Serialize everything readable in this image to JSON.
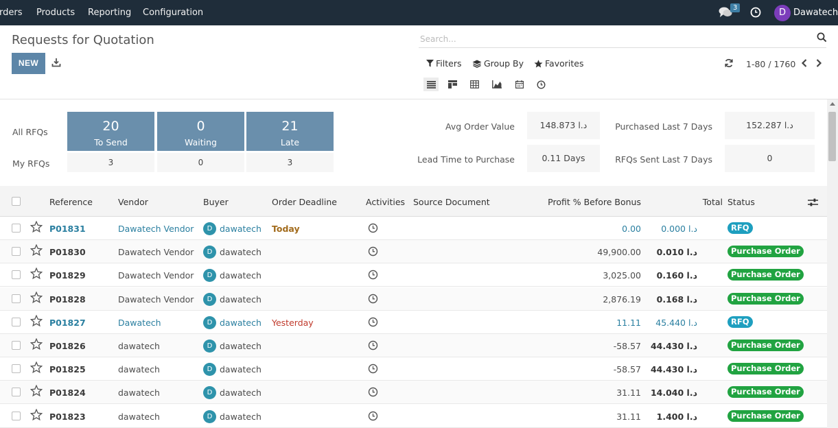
{
  "navbar": {
    "items": [
      "rders",
      "Products",
      "Reporting",
      "Configuration"
    ],
    "chat_badge": "3",
    "user_initial": "D",
    "user_name": "Dawatech"
  },
  "control": {
    "title": "Requests for Quotation",
    "new_label": "NEW",
    "search_placeholder": "Search...",
    "filters_label": "Filters",
    "groupby_label": "Group By",
    "favorites_label": "Favorites",
    "pager": "1-80 / 1760"
  },
  "dashboard": {
    "all_rfqs_label": "All RFQs",
    "my_rfqs_label": "My RFQs",
    "cards": [
      {
        "value": "20",
        "caption": "To Send",
        "my": "3"
      },
      {
        "value": "0",
        "caption": "Waiting",
        "my": "0"
      },
      {
        "value": "21",
        "caption": "Late",
        "my": "3"
      }
    ],
    "stats": [
      {
        "label": "Avg Order Value",
        "value": "148.873  د.ا"
      },
      {
        "label": "Purchased Last 7 Days",
        "value": "152.287  د.ا"
      },
      {
        "label": "Lead Time to Purchase",
        "value": "0.11  Days"
      },
      {
        "label": "RFQs Sent Last 7 Days",
        "value": "0"
      }
    ]
  },
  "table": {
    "headers": {
      "reference": "Reference",
      "vendor": "Vendor",
      "buyer": "Buyer",
      "deadline": "Order Deadline",
      "activities": "Activities",
      "source": "Source Document",
      "profit": "Profit % Before Bonus",
      "total": "Total",
      "status": "Status"
    },
    "rows": [
      {
        "ref": "P01831",
        "vendor": "Dawatech Vendor",
        "buyer": "dawatech",
        "buyer_initial": "D",
        "deadline": "Today",
        "profit": "0.00",
        "total": "0.000  د.ا",
        "status": "RFQ"
      },
      {
        "ref": "P01830",
        "vendor": "Dawatech Vendor",
        "buyer": "dawatech",
        "buyer_initial": "D",
        "deadline": "",
        "profit": "49,900.00",
        "total": "0.010  د.ا",
        "status": "Purchase Order"
      },
      {
        "ref": "P01829",
        "vendor": "Dawatech Vendor",
        "buyer": "dawatech",
        "buyer_initial": "D",
        "deadline": "",
        "profit": "3,025.00",
        "total": "0.160  د.ا",
        "status": "Purchase Order"
      },
      {
        "ref": "P01828",
        "vendor": "Dawatech Vendor",
        "buyer": "dawatech",
        "buyer_initial": "D",
        "deadline": "",
        "profit": "2,876.19",
        "total": "0.168  د.ا",
        "status": "Purchase Order"
      },
      {
        "ref": "P01827",
        "vendor": "Dawatech",
        "buyer": "dawatech",
        "buyer_initial": "D",
        "deadline": "Yesterday",
        "profit": "11.11",
        "total": "45.440  د.ا",
        "status": "RFQ"
      },
      {
        "ref": "P01826",
        "vendor": "dawatech",
        "buyer": "dawatech",
        "buyer_initial": "D",
        "deadline": "",
        "profit": "-58.57",
        "total": "44.430  د.ا",
        "status": "Purchase Order"
      },
      {
        "ref": "P01825",
        "vendor": "dawatech",
        "buyer": "dawatech",
        "buyer_initial": "D",
        "deadline": "",
        "profit": "-58.57",
        "total": "44.430  د.ا",
        "status": "Purchase Order"
      },
      {
        "ref": "P01824",
        "vendor": "dawatech",
        "buyer": "dawatech",
        "buyer_initial": "D",
        "deadline": "",
        "profit": "31.11",
        "total": "14.040  د.ا",
        "status": "Purchase Order"
      },
      {
        "ref": "P01823",
        "vendor": "dawatech",
        "buyer": "dawatech",
        "buyer_initial": "D",
        "deadline": "",
        "profit": "31.11",
        "total": "1.400  د.ا",
        "status": "Purchase Order"
      }
    ]
  },
  "colors": {
    "navbar": "#1f2d3a",
    "primary": "#5d86a8",
    "kpi": "#6a8fac",
    "link": "#2a7fa0",
    "rfq": "#1e9fbf",
    "purchase_order": "#21a341",
    "deadline_today": "#a26b1c",
    "deadline_late": "#c0392b"
  },
  "icons": [
    "chat-icon",
    "clock-icon",
    "download-icon",
    "search-icon",
    "filter-icon",
    "layers-icon",
    "star-icon",
    "refresh-icon",
    "chevron-left-icon",
    "chevron-right-icon",
    "list-view-icon",
    "kanban-view-icon",
    "pivot-view-icon",
    "graph-view-icon",
    "calendar-view-icon",
    "activity-view-icon",
    "optional-columns-icon"
  ]
}
